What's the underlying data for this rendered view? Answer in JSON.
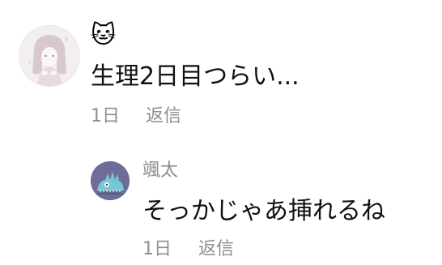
{
  "comments": [
    {
      "author": "🐱",
      "text": "生理2日目つらい...",
      "time": "1日",
      "reply_label": "返信"
    },
    {
      "author": "颯太",
      "text": "そっかじゃあ挿れるね",
      "time": "1日",
      "reply_label": "返信"
    }
  ],
  "colors": {
    "meta_gray": "#8e8e93",
    "text": "#111111",
    "avatar2_bg": "#6f6c9a"
  },
  "icons": {
    "comment1_avatar": "anime-girl-avatar",
    "comment2_avatar": "blue-creature-avatar"
  }
}
